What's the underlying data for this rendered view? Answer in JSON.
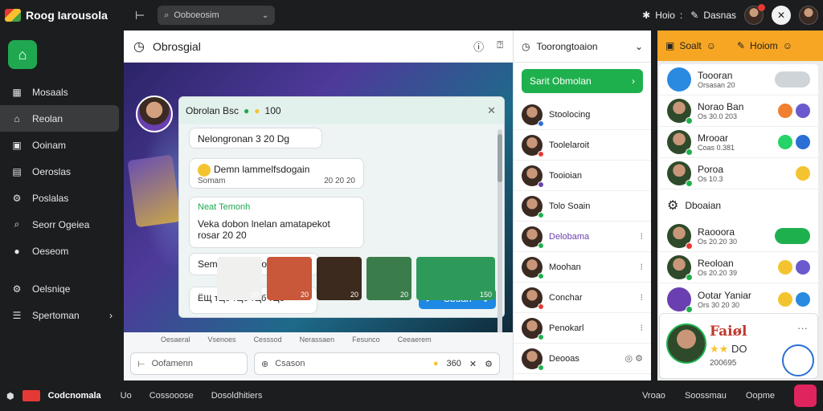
{
  "topbar": {
    "app_name": "Roog Iarousola",
    "search_placeholder": "Ooboeosim",
    "help_label": "Hoio",
    "tools_label": "Dasnas"
  },
  "sidebar": {
    "items": [
      {
        "label": "Mosaals",
        "icon": "grid-icon"
      },
      {
        "label": "Reolan",
        "icon": "home-icon",
        "active": true
      },
      {
        "label": "Ooinam",
        "icon": "calendar-icon"
      },
      {
        "label": "Oeroslas",
        "icon": "table-icon"
      },
      {
        "label": "Poslalas",
        "icon": "settings-icon"
      },
      {
        "label": "Seorr Ogeiea",
        "icon": "search-icon"
      },
      {
        "label": "Oeseom",
        "icon": "user-icon"
      },
      {
        "label": "Oelsniqe",
        "icon": "settings-icon"
      },
      {
        "label": "Spertoman",
        "icon": "list-icon"
      }
    ]
  },
  "main": {
    "title": "Obrosgial",
    "chat": {
      "header": "Obrolan Bsc",
      "header_count": "100",
      "messages": [
        {
          "text": "Nelongronan 3 20 Dg"
        },
        {
          "text": "Demn lammelfsdogain",
          "sub": "Somam",
          "time": "20 20 20"
        },
        {
          "name": "Neat Temonh",
          "text": "Veka dobon lnelan amatapekot",
          "sub": "rosar 20 20"
        },
        {
          "text": "Semobincbosdon"
        }
      ],
      "input_placeholder": "Cbuan",
      "reactions": "ЁЩ тЦб тЦб тЦб тЦб"
    },
    "tiles": [
      {
        "label": "Oesaeral",
        "overlay": "20"
      },
      {
        "label": "Vsenoes",
        "overlay": "20"
      },
      {
        "label": "Cesssod",
        "overlay": "20"
      },
      {
        "label": "Nerassaen",
        "overlay": "20"
      },
      {
        "label": "Fesunco",
        "overlay": "20"
      },
      {
        "label": "Ceeaerem",
        "overlay": "150"
      }
    ],
    "footer": {
      "field1": "Oofamenn",
      "field2": "Csason",
      "field2_count": "360"
    }
  },
  "mid": {
    "header": "Toorongtoaion",
    "green_button": "Sarit Obmolan",
    "rows": [
      {
        "label": "Stoolocing"
      },
      {
        "label": "Toolelaroit"
      },
      {
        "label": "Tooioian"
      },
      {
        "label": "Tolo Soain"
      },
      {
        "label": "Delobama",
        "purple": true
      },
      {
        "label": "Moohan"
      },
      {
        "label": "Conchar"
      },
      {
        "label": "Penokarl"
      },
      {
        "label": "Deooas"
      }
    ]
  },
  "right": {
    "head_left": "Soalt",
    "head_right": "Hoiom",
    "rows": [
      {
        "name": "Toooran",
        "sub": "Orsasan 20"
      },
      {
        "name": "Norao Ban",
        "sub": "Os 30.0 203"
      },
      {
        "name": "Mrooar",
        "sub": "Coas 0.381"
      },
      {
        "name": "Poroa",
        "sub": "Os 10.3"
      },
      {
        "name": "Dboaian"
      },
      {
        "name": "Raooora",
        "sub": "Os 20.20 30"
      },
      {
        "name": "Reoloan",
        "sub": "Os 20.20 39"
      },
      {
        "name": "Ootar Yaniar",
        "sub": "Ors 30 20 30"
      }
    ],
    "card": {
      "title": "Faiøl",
      "line2": "DO",
      "line3": "200695"
    }
  },
  "bottombar": {
    "brand": "Codcnomala",
    "links": [
      "Uo",
      "Cossooose",
      "Dosoldhitiers"
    ],
    "right": [
      "Vroao",
      "Soossmau",
      "Oopme"
    ]
  },
  "colors": {
    "accent_green": "#1fb04e",
    "accent_blue": "#1e88e5",
    "accent_orange": "#f6a623"
  }
}
